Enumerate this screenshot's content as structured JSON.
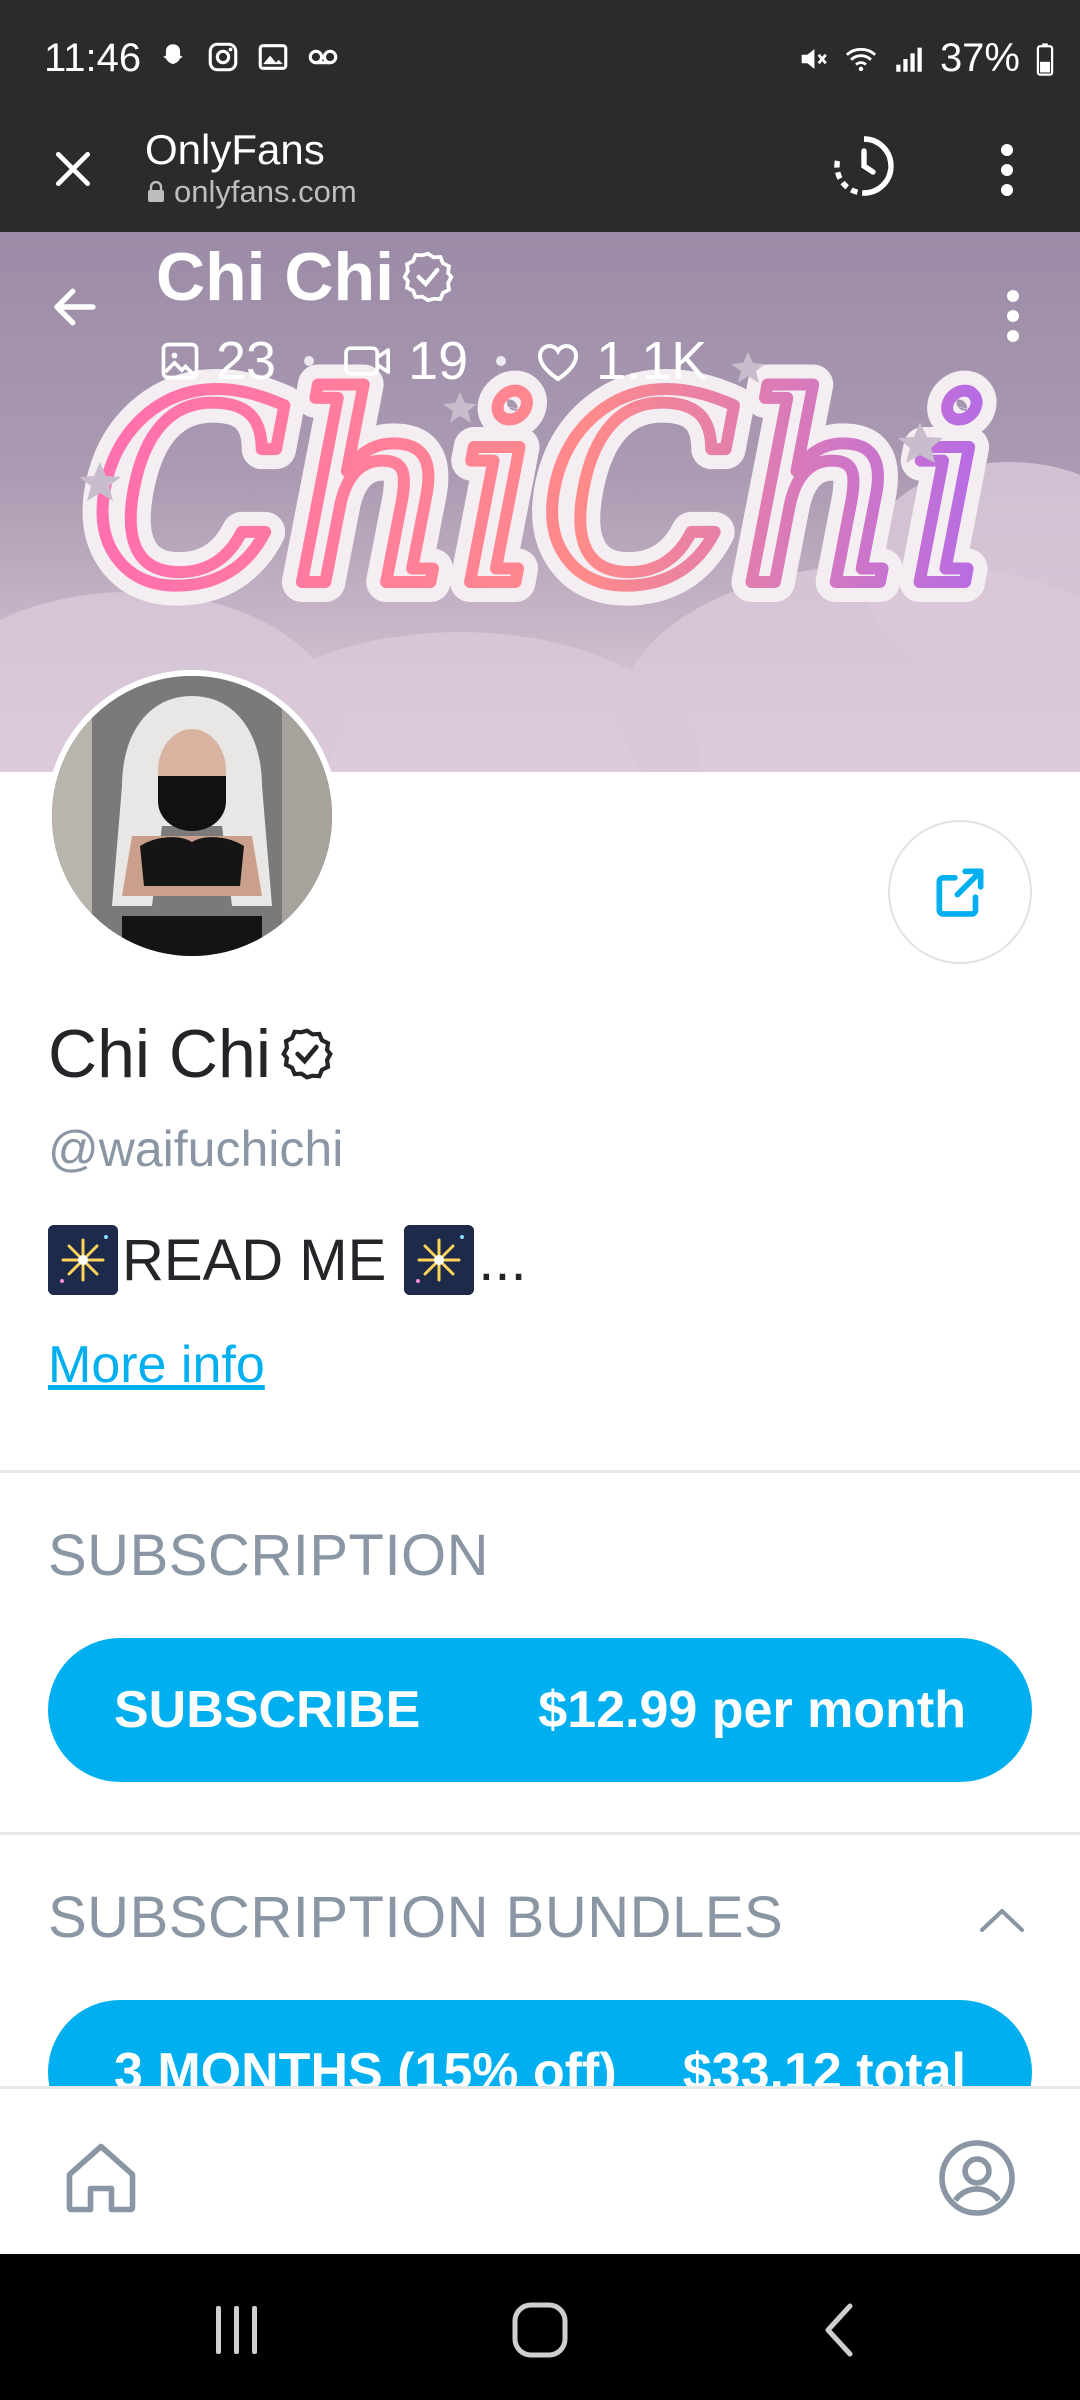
{
  "status_bar": {
    "time": "11:46",
    "battery": "37%"
  },
  "toolbar": {
    "title": "OnlyFans",
    "url": "onlyfans.com"
  },
  "banner": {
    "name": "Chi Chi",
    "logo_text": "ChiChi",
    "stats": {
      "photos": "23",
      "videos": "19",
      "likes": "1.1K"
    }
  },
  "profile": {
    "name": "Chi Chi",
    "handle": "@waifuchichi",
    "bio": "READ ME",
    "bio_ellipsis": "...",
    "more_info": "More info"
  },
  "subscription": {
    "section_title": "SUBSCRIPTION",
    "button_label": "SUBSCRIBE",
    "price": "$12.99 per month"
  },
  "bundles": {
    "section_title": "SUBSCRIPTION BUNDLES",
    "items": [
      {
        "label": "3 MONTHS (15% off)",
        "price": "$33.12 total"
      }
    ]
  },
  "colors": {
    "accent": "#00aff0",
    "text_primary": "#242529",
    "text_muted": "#8a96a3",
    "toolbar_bg": "#2b2b2b"
  },
  "icons": {
    "close": "close-icon",
    "history": "history-icon",
    "more": "more-vert-icon",
    "back": "arrow-left-icon",
    "photo": "image-icon",
    "video": "video-icon",
    "like": "heart-icon",
    "verified": "verified-badge-icon",
    "share": "share-icon",
    "chevron": "chevron-up-icon",
    "home": "home-icon",
    "profile": "user-circle-icon"
  }
}
